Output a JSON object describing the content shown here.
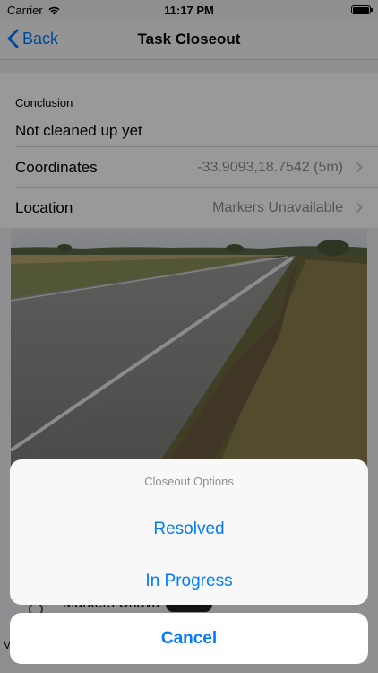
{
  "status_bar": {
    "carrier": "Carrier",
    "time": "11:17 PM"
  },
  "nav": {
    "back_label": "Back",
    "title": "Task Closeout"
  },
  "conclusion": {
    "label": "Conclusion",
    "value": "Not cleaned up yet"
  },
  "rows": [
    {
      "label": "Coordinates",
      "value": "-33.9093,18.7542 (5m)"
    },
    {
      "label": "Location",
      "value": "Markers Unavailable"
    }
  ],
  "photo": {
    "description_icon": "road-photo"
  },
  "behind": {
    "text": "Markers Unava",
    "left_text": "V"
  },
  "action_sheet": {
    "title": "Closeout Options",
    "options": [
      "Resolved",
      "In Progress"
    ],
    "cancel_label": "Cancel"
  },
  "colors": {
    "accent": "#007aff",
    "secondary_text": "#8e8e93",
    "background": "#efeff4"
  }
}
